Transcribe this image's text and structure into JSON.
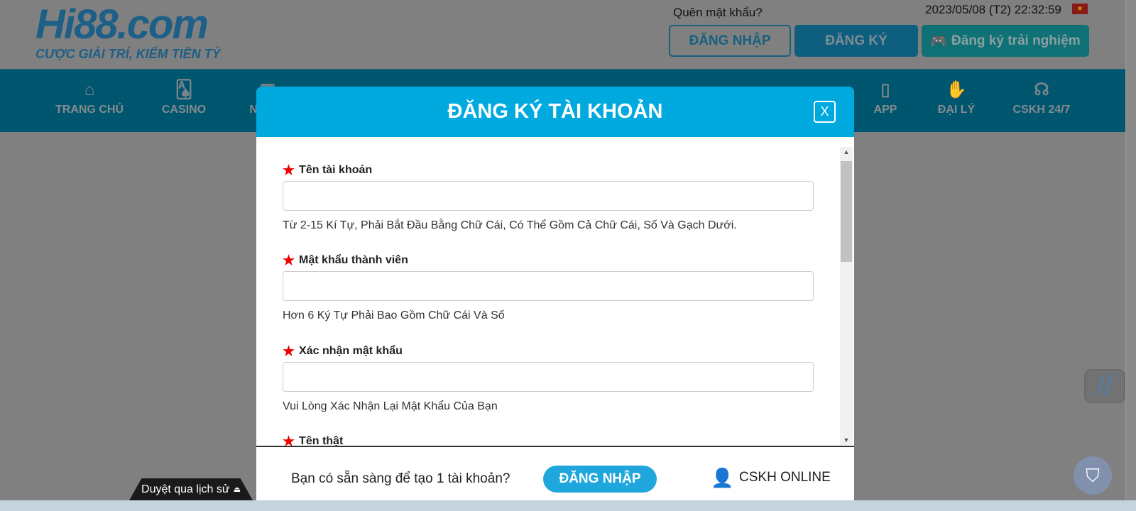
{
  "header": {
    "logo": "Hi88.com",
    "tagline": "CƯỢC GIẢI TRÍ, KIẾM TIỀN TỶ",
    "forgot_password": "Quên mật khẩu?",
    "datetime": "2023/05/08 (T2) 22:32:59",
    "login": "ĐĂNG NHẬP",
    "register": "ĐĂNG KÝ",
    "trial": "Đăng ký trải nghiệm",
    "trial_icon": "gamepad-icon",
    "flag_icon": "vietnam-flag-icon"
  },
  "nav": [
    {
      "label": "TRANG CHỦ",
      "icon": "home-icon"
    },
    {
      "label": "CASINO",
      "icon": "cards-icon"
    },
    {
      "label": "NỔ HŨ",
      "icon": "slot-icon"
    },
    {
      "label": "APP",
      "icon": "phone-icon"
    },
    {
      "label": "ĐẠI LÝ",
      "icon": "handshake-icon"
    },
    {
      "label": "CSKH 24/7",
      "icon": "headset-24-icon"
    }
  ],
  "modal": {
    "title": "ĐĂNG KÝ TÀI KHOẢN",
    "close": "X",
    "fields": [
      {
        "label": "Tên tài khoản",
        "value": "",
        "hint": "Từ 2-15 Kí Tự, Phải Bắt Đầu Bằng Chữ Cái, Có Thể Gồm Cả Chữ Cái, Số Và Gạch Dưới."
      },
      {
        "label": "Mật khẩu thành viên",
        "value": "",
        "hint": "Hơn 6 Ký Tự Phải Bao Gồm Chữ Cái Và Số"
      },
      {
        "label": "Xác nhận mật khẩu",
        "value": "",
        "hint": "Vui Lòng Xác Nhận Lại Mật Khẩu Của Bạn"
      },
      {
        "label": "Tên thật"
      }
    ],
    "footer": {
      "question": "Bạn có sẵn sàng để tạo 1 tài khoản?",
      "login": "ĐĂNG NHẬP",
      "support": "CSKH ONLINE"
    }
  },
  "history_tab": "Duyệt qua lịch sử",
  "colors": {
    "modal_header": "#00a9de",
    "nav": "#00556f",
    "required_star": "#ee0000"
  }
}
